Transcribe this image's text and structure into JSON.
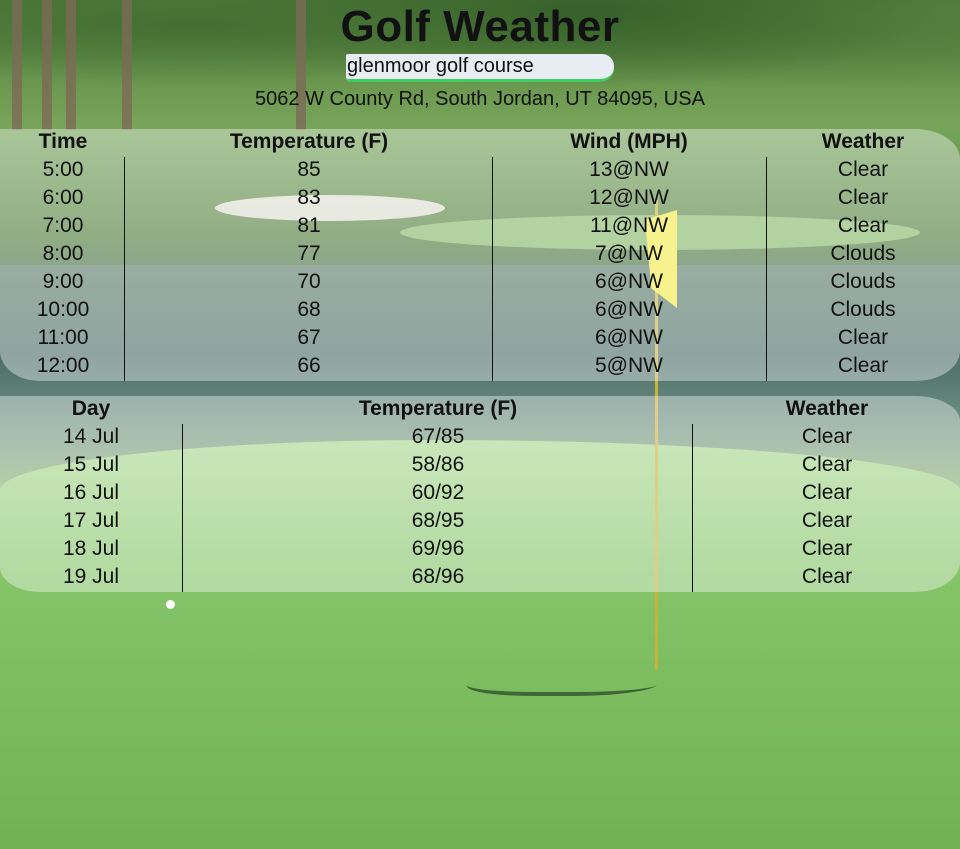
{
  "app": {
    "title": "Golf Weather",
    "search_value": "glenmoor golf course",
    "address": "5062 W County Rd, South Jordan, UT 84095, USA"
  },
  "hourly": {
    "headers": [
      "Time",
      "Temperature (F)",
      "Wind (MPH)",
      "Weather"
    ],
    "rows": [
      {
        "time": "5:00",
        "temp": "85",
        "wind": "13@NW",
        "weather": "Clear"
      },
      {
        "time": "6:00",
        "temp": "83",
        "wind": "12@NW",
        "weather": "Clear"
      },
      {
        "time": "7:00",
        "temp": "81",
        "wind": "11@NW",
        "weather": "Clear"
      },
      {
        "time": "8:00",
        "temp": "77",
        "wind": "7@NW",
        "weather": "Clouds"
      },
      {
        "time": "9:00",
        "temp": "70",
        "wind": "6@NW",
        "weather": "Clouds"
      },
      {
        "time": "10:00",
        "temp": "68",
        "wind": "6@NW",
        "weather": "Clouds"
      },
      {
        "time": "11:00",
        "temp": "67",
        "wind": "6@NW",
        "weather": "Clear"
      },
      {
        "time": "12:00",
        "temp": "66",
        "wind": "5@NW",
        "weather": "Clear"
      }
    ]
  },
  "daily": {
    "headers": [
      "Day",
      "Temperature (F)",
      "Weather"
    ],
    "rows": [
      {
        "day": "14 Jul",
        "temp": "67/85",
        "weather": "Clear"
      },
      {
        "day": "15 Jul",
        "temp": "58/86",
        "weather": "Clear"
      },
      {
        "day": "16 Jul",
        "temp": "60/92",
        "weather": "Clear"
      },
      {
        "day": "17 Jul",
        "temp": "68/95",
        "weather": "Clear"
      },
      {
        "day": "18 Jul",
        "temp": "69/96",
        "weather": "Clear"
      },
      {
        "day": "19 Jul",
        "temp": "68/96",
        "weather": "Clear"
      }
    ]
  },
  "colors": {
    "search_underline": "#3fcf61",
    "search_bg": "#e8edf4"
  }
}
